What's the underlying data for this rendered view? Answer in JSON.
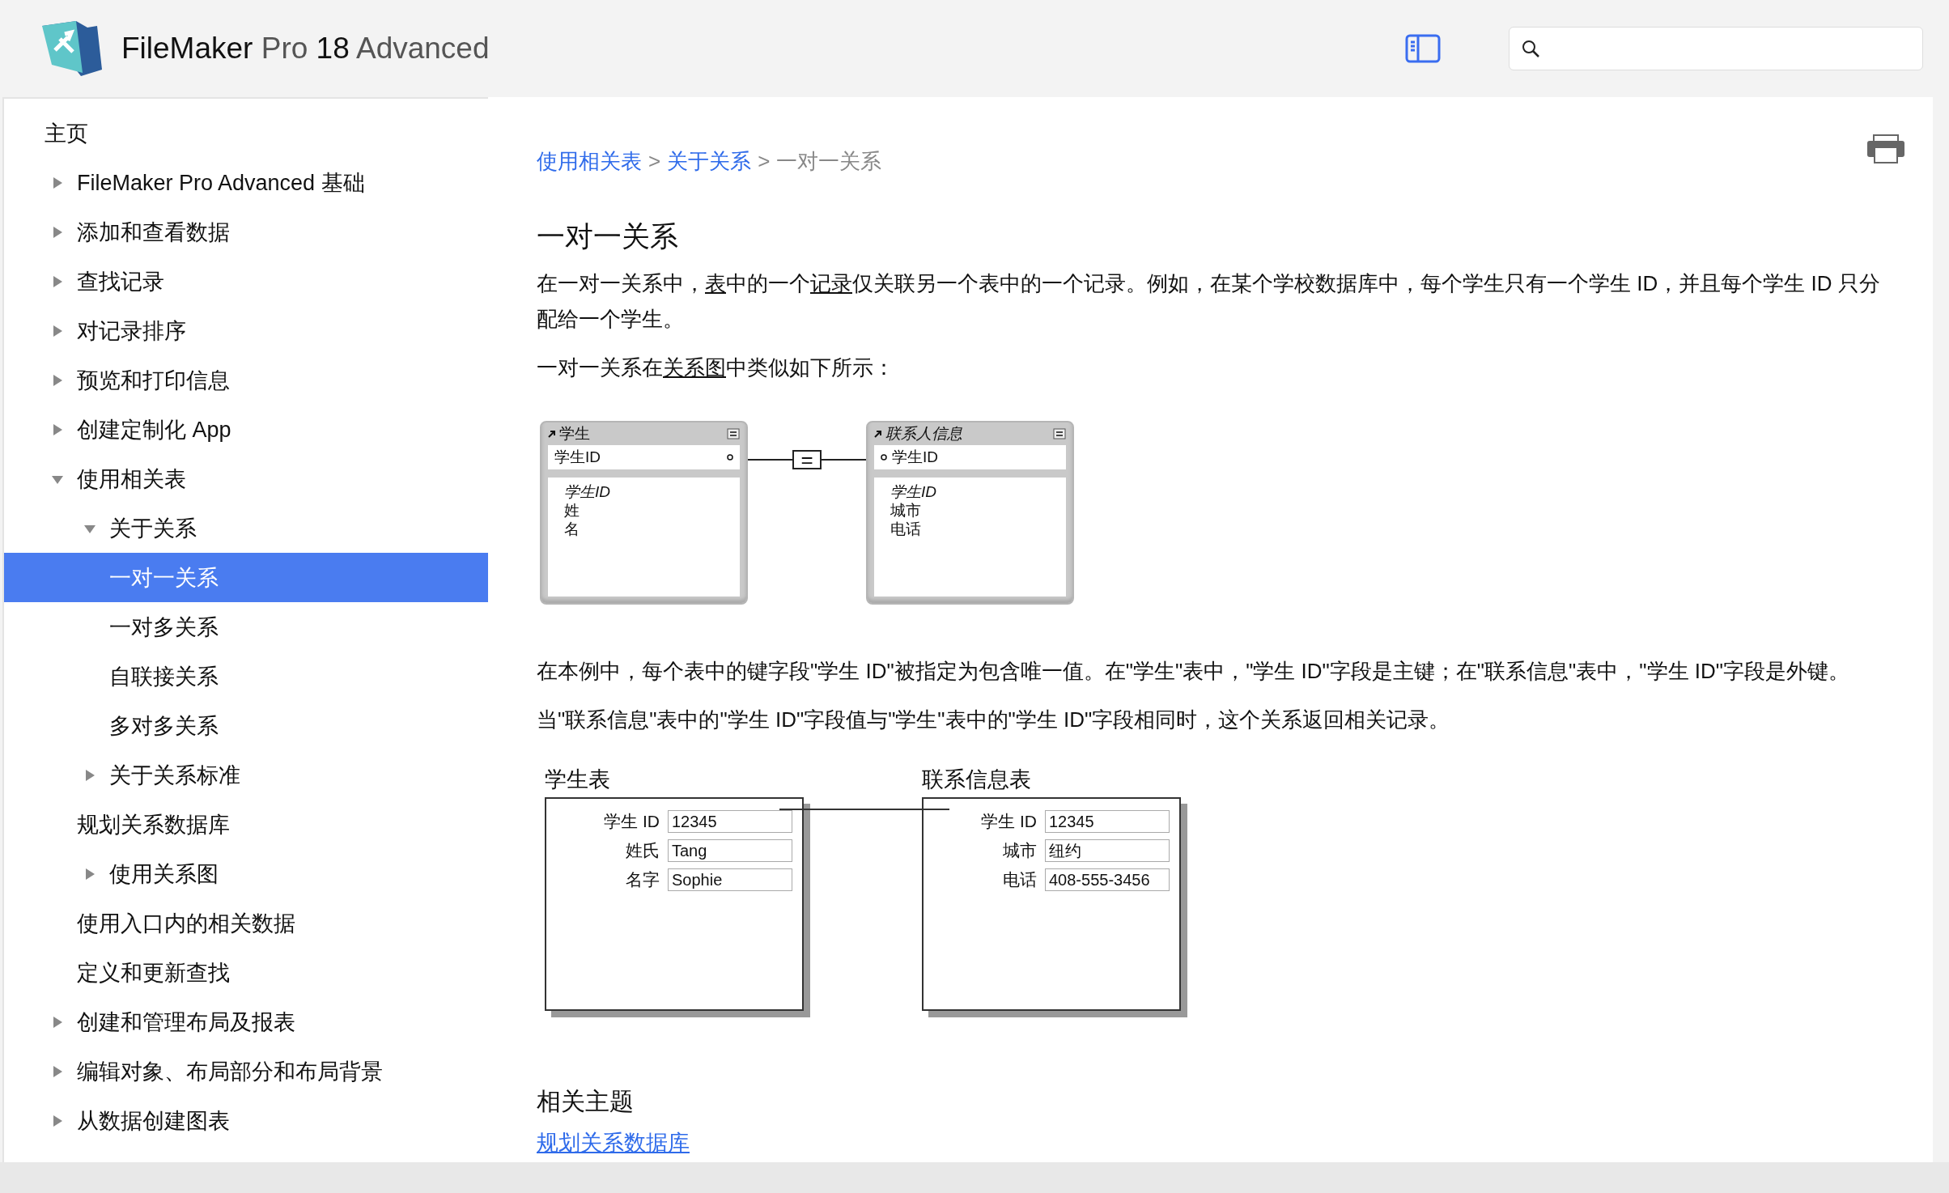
{
  "header": {
    "title": "**FileMaker** Pro **18** Advanced"
  },
  "sidebar": {
    "items": [
      {
        "label": "主页",
        "kind": "leaf",
        "selected": false
      },
      {
        "label": "FileMaker Pro Advanced 基础",
        "kind": "branch",
        "expanded": false,
        "selected": false
      },
      {
        "label": "添加和查看数据",
        "kind": "branch",
        "expanded": false,
        "selected": false
      },
      {
        "label": "查找记录",
        "kind": "branch",
        "expanded": false,
        "selected": false
      },
      {
        "label": "对记录排序",
        "kind": "branch",
        "expanded": false,
        "selected": false
      },
      {
        "label": "预览和打印信息",
        "kind": "branch",
        "expanded": false,
        "selected": false
      },
      {
        "label": "创建定制化 App",
        "kind": "branch",
        "expanded": false,
        "selected": false
      },
      {
        "label": "使用相关表",
        "kind": "branch",
        "expanded": true,
        "selected": false,
        "children": [
          {
            "label": "关于关系",
            "kind": "branch",
            "expanded": true,
            "selected": false,
            "children": [
              {
                "label": "一对一关系",
                "kind": "leaf",
                "selected": true
              },
              {
                "label": "一对多关系",
                "kind": "leaf",
                "selected": false
              },
              {
                "label": "自联接关系",
                "kind": "leaf",
                "selected": false
              },
              {
                "label": "多对多关系",
                "kind": "leaf",
                "selected": false
              }
            ]
          },
          {
            "label": "关于关系标准",
            "kind": "branch",
            "expanded": false,
            "selected": false
          },
          {
            "label": "规划关系数据库",
            "kind": "leaf",
            "selected": false
          },
          {
            "label": "使用关系图",
            "kind": "branch",
            "expanded": false,
            "selected": false
          },
          {
            "label": "使用入口内的相关数据",
            "kind": "leaf",
            "selected": false
          },
          {
            "label": "定义和更新查找",
            "kind": "leaf",
            "selected": false
          }
        ]
      },
      {
        "label": "创建和管理布局及报表",
        "kind": "branch",
        "expanded": false,
        "selected": false
      },
      {
        "label": "编辑对象、布局部分和布局背景",
        "kind": "branch",
        "expanded": false,
        "selected": false
      },
      {
        "label": "从数据创建图表",
        "kind": "branch",
        "expanded": false,
        "selected": false
      }
    ]
  },
  "breadcrumb": [
    {
      "text": "使用相关表",
      "kind": "link"
    },
    {
      "text": ">",
      "kind": "separator"
    },
    {
      "text": "关于关系",
      "kind": "link"
    },
    {
      "text": ">",
      "kind": "separator"
    },
    {
      "text": "一对一关系",
      "kind": "current"
    }
  ],
  "article": {
    "title": "一对一关系",
    "intro": [
      {
        "text": "在一对一关系中，",
        "link": false
      },
      {
        "text": "表",
        "link": true
      },
      {
        "text": "中的一个",
        "link": false
      },
      {
        "text": "记录",
        "link": true
      },
      {
        "text": "仅关联另一个表中的一个记录。例如，在某个学校数据库中，每个学生只有一个学生 ID，并且每个学生 ID 只分配给一个学生。",
        "link": false
      }
    ],
    "graph_caption": [
      {
        "text": "一对一关系在",
        "link": false
      },
      {
        "text": "关系图",
        "link": true
      },
      {
        "text": "中类似如下所示：",
        "link": false
      }
    ],
    "relationship_graph": {
      "operator": "=",
      "tables": [
        {
          "name": "学生",
          "italic": false,
          "match_field": "学生ID",
          "fields": [
            {
              "text": "学生ID",
              "italic": true
            },
            {
              "text": "姓",
              "italic": false
            },
            {
              "text": "名",
              "italic": false
            }
          ]
        },
        {
          "name": "联系人信息",
          "italic": true,
          "match_field": "学生ID",
          "fields": [
            {
              "text": "学生ID",
              "italic": true
            },
            {
              "text": "城市",
              "italic": false
            },
            {
              "text": "电话",
              "italic": false
            }
          ]
        }
      ]
    },
    "paragraphs": [
      "在本例中，每个表中的键字段\"学生 ID\"被指定为包含唯一值。在\"学生\"表中，\"学生 ID\"字段是主键；在\"联系信息\"表中，\"学生 ID\"字段是外键。",
      "当\"联系信息\"表中的\"学生 ID\"字段值与\"学生\"表中的\"学生 ID\"字段相同时，这个关系返回相关记录。"
    ],
    "layouts": [
      {
        "title": "学生表",
        "fields": [
          {
            "label": "学生 ID",
            "value": "12345"
          },
          {
            "label": "姓氏",
            "value": "Tang"
          },
          {
            "label": "名字",
            "value": "Sophie"
          }
        ]
      },
      {
        "title": "联系信息表",
        "fields": [
          {
            "label": "学生 ID",
            "value": "12345"
          },
          {
            "label": "城市",
            "value": "纽约"
          },
          {
            "label": "电话",
            "value": "408-555-3456"
          }
        ]
      }
    ],
    "related": {
      "title": "相关主题",
      "links": [
        "规划关系数据库"
      ]
    }
  }
}
